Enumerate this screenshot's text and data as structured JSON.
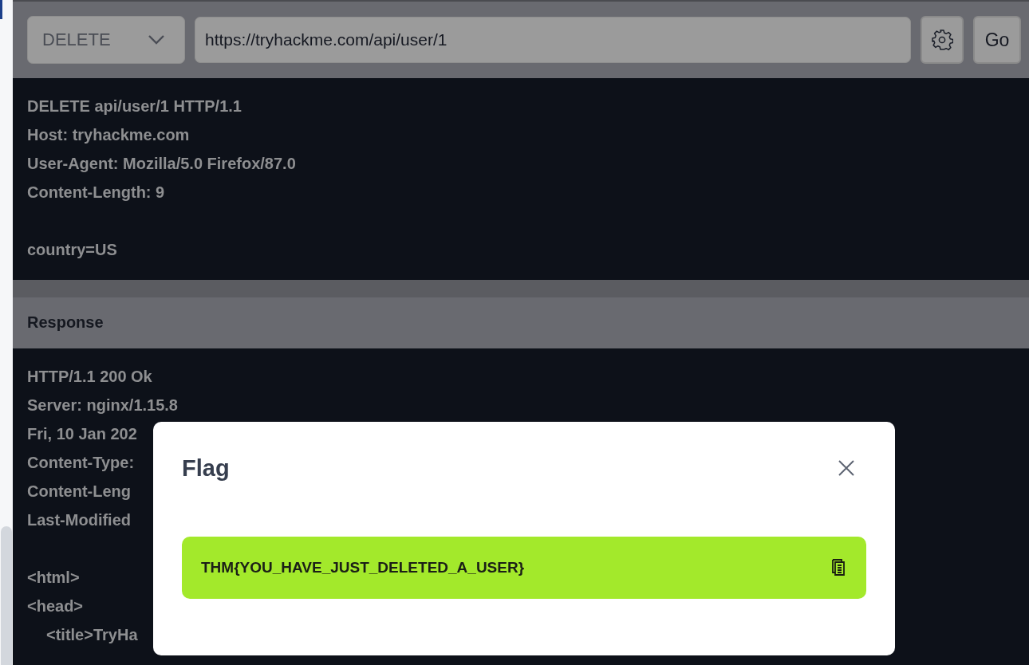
{
  "toolbar": {
    "method": "DELETE",
    "url": "https://tryhackme.com/api/user/1",
    "go_button": "Go"
  },
  "request": {
    "headers": [
      "DELETE api/user/1 HTTP/1.1",
      "Host: tryhackme.com",
      "User-Agent: Mozilla/5.0 Firefox/87.0",
      "Content-Length: 9"
    ],
    "body": [
      {
        "text": "country=US"
      }
    ]
  },
  "response": {
    "title": "Response",
    "headers": [
      "HTTP/1.1 200 Ok",
      "Server: nginx/1.15.8",
      "Fri, 10 Jan 202",
      "Content-Type:",
      "Content-Leng",
      "Last-Modified"
    ],
    "body": [
      {
        "text": "<html>"
      },
      {
        "text": "<head>",
        "children": [
          {
            "text": "<title>TryHa"
          }
        ]
      }
    ]
  },
  "modal": {
    "title": "Flag",
    "flag": "THM{YOU_HAVE_JUST_DELETED_A_USER}"
  }
}
